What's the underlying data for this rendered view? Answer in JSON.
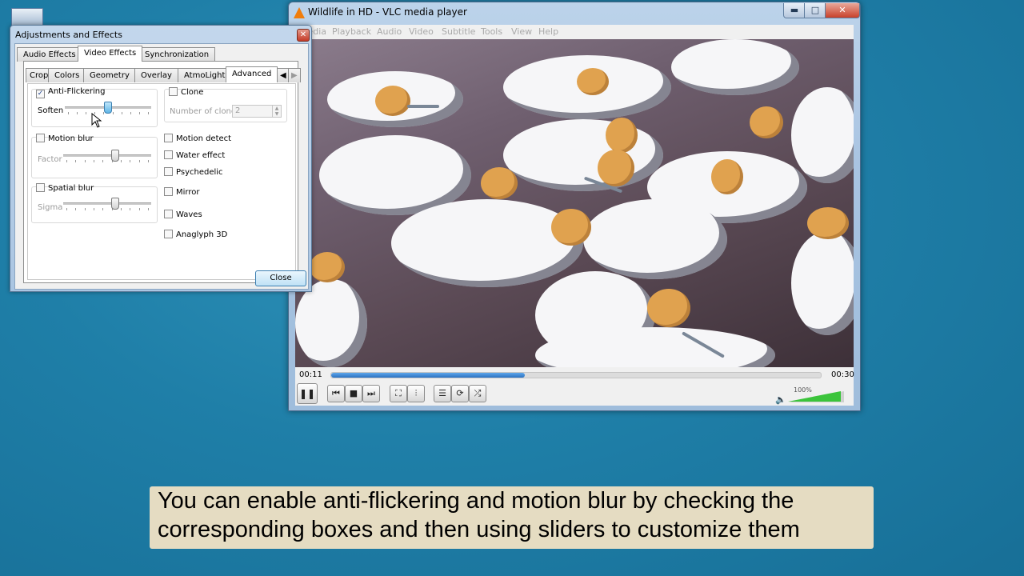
{
  "vlc": {
    "title": "Wildlife in HD - VLC media player",
    "caption_buttons": {
      "min": "▬",
      "max": "□",
      "close": "✕"
    },
    "menu": [
      "Media",
      "Playback",
      "Audio",
      "Video",
      "Subtitle",
      "Tools",
      "View",
      "Help"
    ],
    "elapsed": "00:11",
    "total": "00:30",
    "progress_fraction": 0.395,
    "volume_label": "100%",
    "volume_fraction": 1.0,
    "buttons": {
      "pause": "❚❚",
      "prev": "⏮",
      "stop": "■",
      "next": "⏭",
      "fullscreen": "⛶",
      "extended": "⫶",
      "playlist": "☰",
      "loop": "⟳",
      "random": "⤮"
    },
    "icons": {
      "volume": "🔈"
    }
  },
  "dialog": {
    "title": "Adjustments and Effects",
    "close_x": "✕",
    "tabs": [
      "Audio Effects",
      "Video Effects",
      "Synchronization"
    ],
    "active_tab": "Video Effects",
    "subtabs": [
      "Crop",
      "Colors",
      "Geometry",
      "Overlay",
      "AtmoLight",
      "Advanced"
    ],
    "active_subtab": "Advanced",
    "scroll_left": "◀",
    "scroll_right": "▶",
    "anti_flickering": {
      "label": "Anti-Flickering",
      "checked": true,
      "check_mark": "✓",
      "slider_label": "Soften",
      "value_fraction": 0.5
    },
    "motion_blur": {
      "label": "Motion blur",
      "checked": false,
      "slider_label": "Factor",
      "value_fraction": 0.6
    },
    "spatial_blur": {
      "label": "Spatial blur",
      "checked": false,
      "slider_label": "Sigma",
      "value_fraction": 0.6
    },
    "clone": {
      "label": "Clone",
      "checked": false,
      "count_label": "Number of clones",
      "count_value": "2",
      "spin_up": "▲",
      "spin_down": "▼"
    },
    "options": [
      "Motion detect",
      "Water effect",
      "Psychedelic",
      "Mirror",
      "Waves",
      "Anaglyph 3D"
    ],
    "close_button": "Close"
  },
  "subtitle_caption": {
    "line1": "You can enable anti-flickering and motion blur by checking the",
    "line2": "corresponding boxes and then using sliders to customize them"
  }
}
